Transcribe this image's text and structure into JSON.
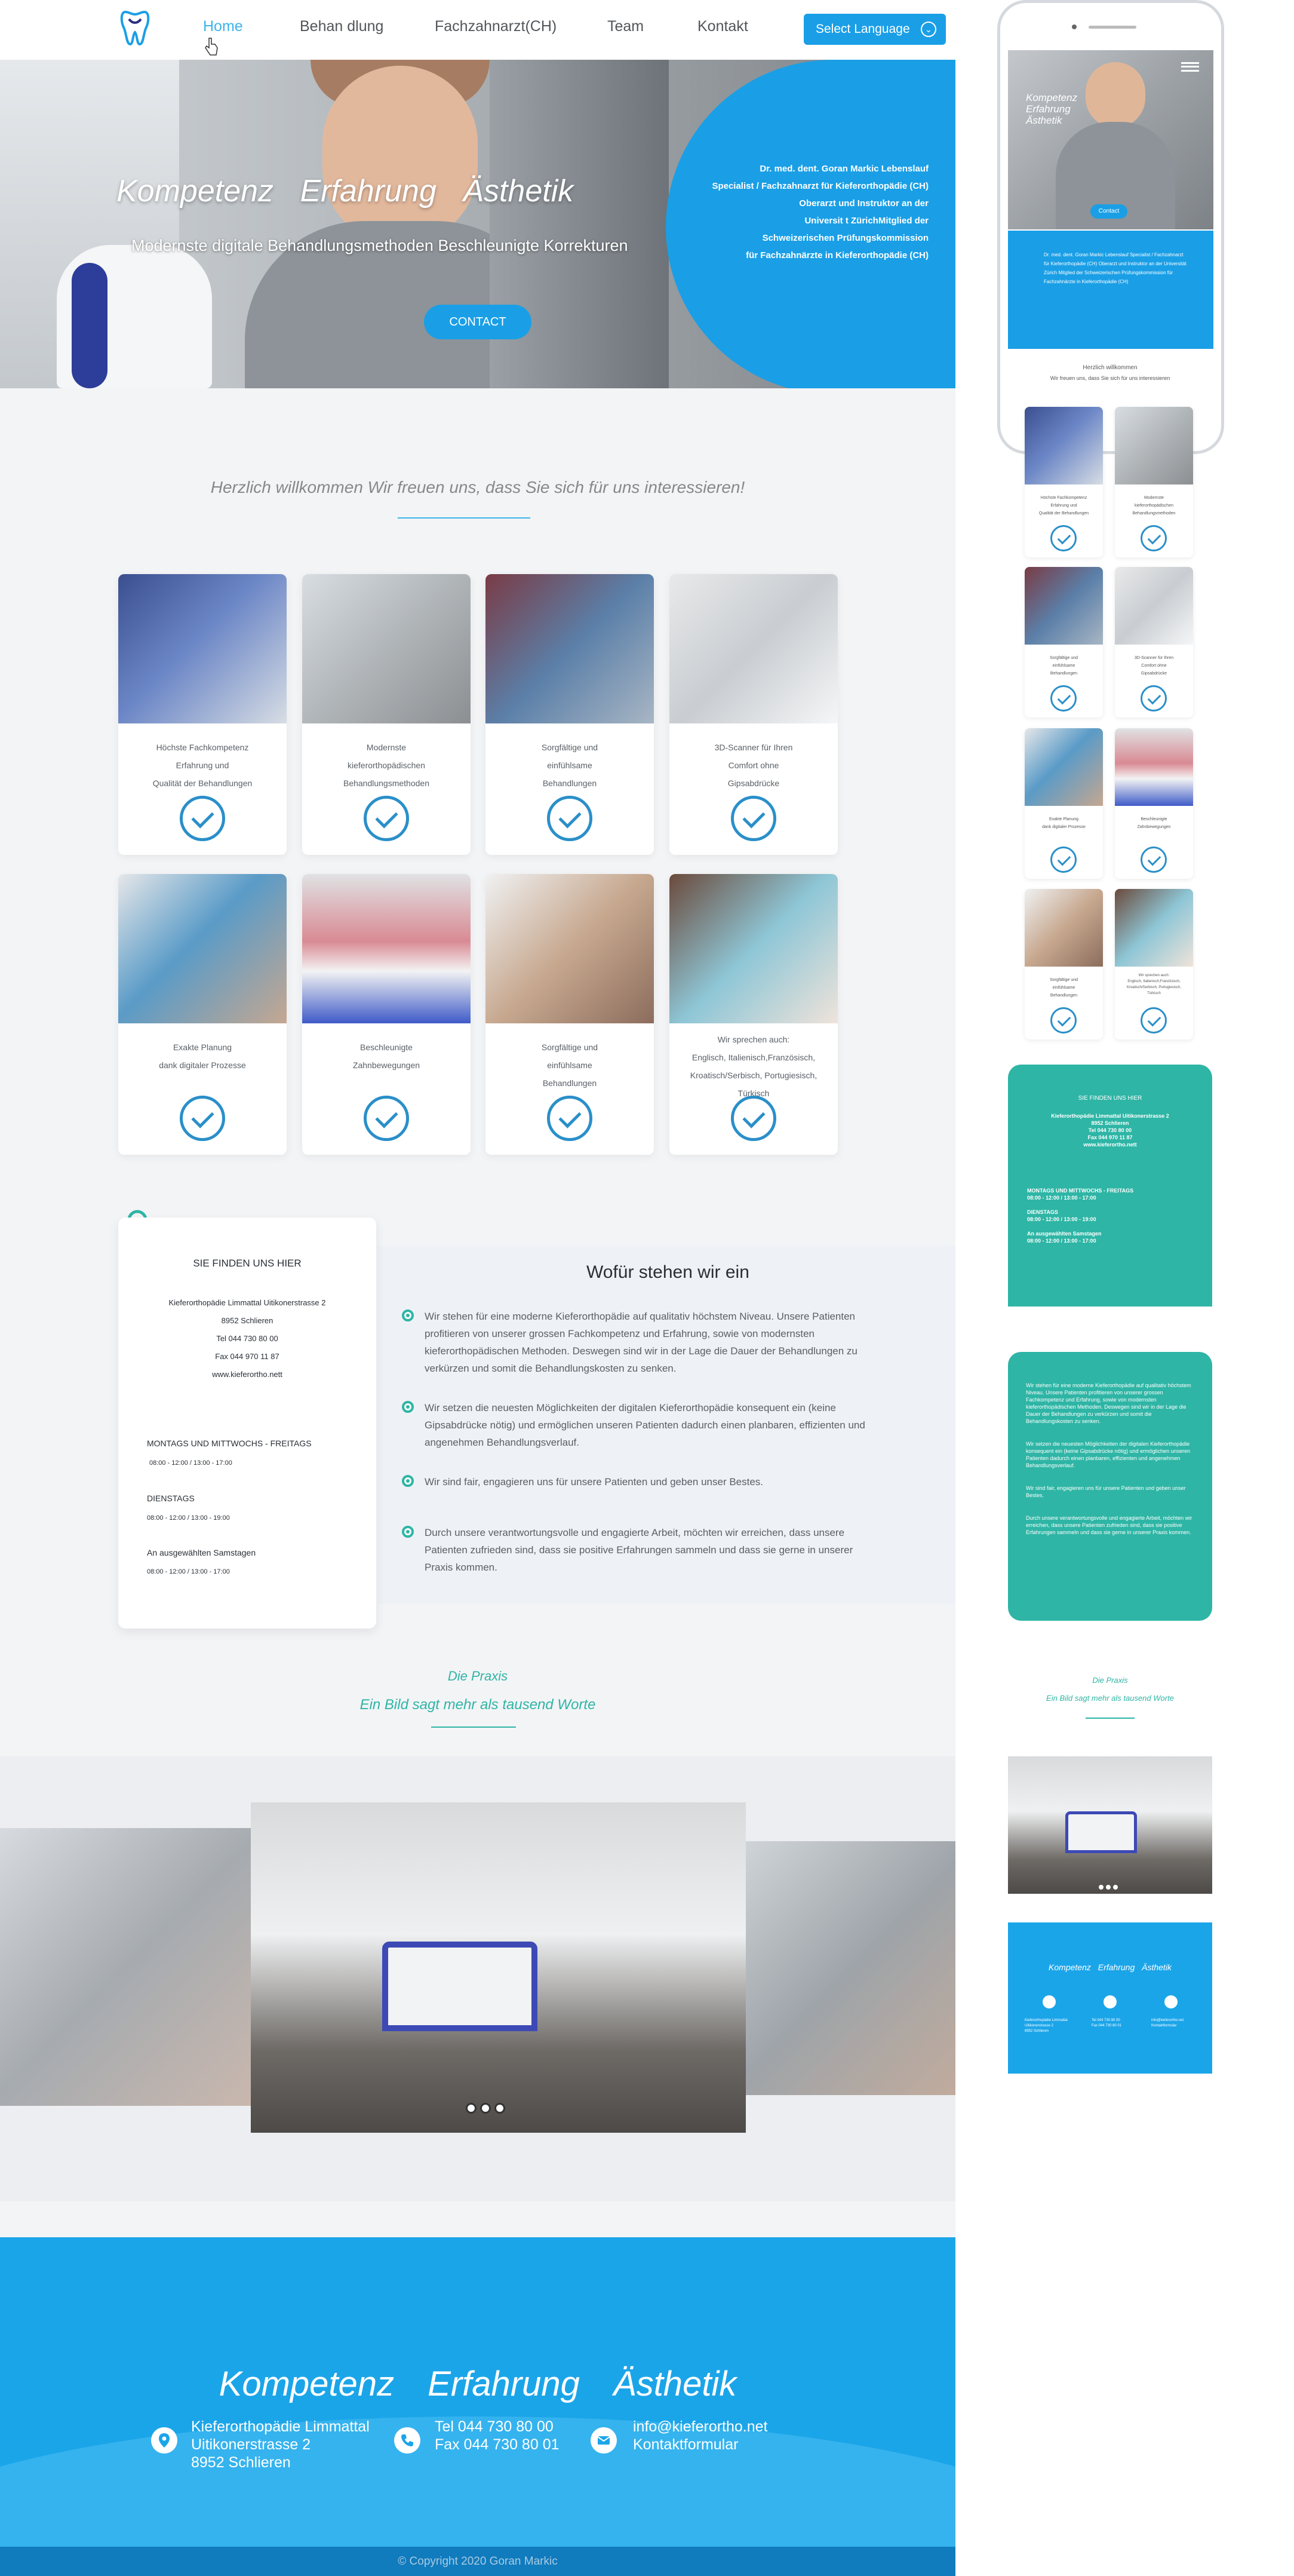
{
  "nav": {
    "items": [
      "Home",
      "Behan dlung",
      "Fachzahnarzt(CH)",
      "Team",
      "Kontakt"
    ],
    "language_button": "Select Language"
  },
  "hero": {
    "title": "Kompetenz  Erfahrung  Ästhetik",
    "subtitle": "Modernste digitale Behandlungsmethoden Beschleunigte Korrekturen",
    "cv_lines": [
      "Dr. med. dent. Goran Markic Lebenslauf",
      "Specialist / Fachzahnarzt für Kieferorthopädie (CH)",
      "Oberarzt und Instruktor an der",
      "Universit t ZürichMitglied der",
      "Schweizerischen Prüfungskommission",
      "für Fachzahnärzte in Kieferorthopädie (CH)"
    ],
    "contact_button": "CONTACT"
  },
  "welcome": "Herzlich willkommen Wir freuen uns, dass Sie sich für uns interessieren!",
  "services": [
    {
      "lines": [
        "Höchste Fachkompetenz",
        "Erfahrung und",
        "Qualität der Behandlungen"
      ]
    },
    {
      "lines": [
        "Modernste",
        "kieferorthopädischen",
        "Behandlungsmethoden"
      ]
    },
    {
      "lines": [
        "Sorgfältige und",
        "einfühlsame",
        "Behandlungen"
      ]
    },
    {
      "lines": [
        "3D-Scanner für Ihren",
        "Comfort ohne",
        "Gipsabdrücke"
      ]
    },
    {
      "lines": [
        "Exakte Planung",
        "dank digitaler Prozesse"
      ]
    },
    {
      "lines": [
        "Beschleunigte",
        "Zahnbewegungen"
      ]
    },
    {
      "lines": [
        "Sorgfältige und",
        "einfühlsame",
        "Behandlungen"
      ]
    },
    {
      "lines": [
        "Wir sprechen auch:",
        "Englisch, Italienisch,Französisch,",
        "Kroatisch/Serbisch, Portugiesisch,",
        "Türkisch"
      ]
    }
  ],
  "info": {
    "heading": "SIE FINDEN UNS HIER",
    "address_lines": [
      "Kieferorthopädie Limmattal Uitikonerstrasse 2",
      "8952 Schlieren",
      "Tel 044 730 80 00",
      "Fax 044 970 11 87",
      "www.kieferortho.nett"
    ],
    "hours": [
      {
        "label": "MONTAGS UND MITTWOCHS - FREITAGS",
        "time": "08:00 - 12:00 / 13:00 - 17:00"
      },
      {
        "label": "DIENSTAGS",
        "time": "08:00 - 12:00 / 13:00 - 19:00"
      },
      {
        "label": "An ausgewählten Samstagen",
        "time": "08:00 - 12:00 / 13:00 - 17:00"
      }
    ]
  },
  "values": {
    "title": "Wofür stehen wir ein",
    "items": [
      "Wir stehen für eine moderne Kieferorthopädie auf qualitativ höchstem Niveau. Unsere Patienten profitieren von unserer grossen Fachkompetenz und Erfahrung, sowie von modernsten kieferorthopädischen Methoden. Deswegen sind wir in der Lage die Dauer der Behandlungen zu verkürzen und somit die Behandlungskosten zu senken.",
      "Wir setzen die neuesten Möglichkeiten der digitalen Kieferorthopädie konsequent ein (keine Gipsabdrücke nötig) und ermöglichen unseren Patienten dadurch einen planbaren, effizienten und angenehmen Behandlungsverlauf.",
      "Wir sind fair, engagieren uns für unsere Patienten und geben unser Bestes.",
      "Durch unsere verantwortungsvolle und engagierte Arbeit, möchten wir erreichen, dass unsere Patienten zufrieden sind, dass sie positive Erfahrungen sammeln und dass sie gerne in unserer Praxis kommen."
    ]
  },
  "praxis": {
    "title": "Die Praxis",
    "subtitle": "Ein Bild sagt mehr als tausend Worte"
  },
  "footer": {
    "slogan": "Kompetenz  Erfahrung  Ästhetik",
    "address": [
      "Kieferorthopädie Limmattal",
      "Uitikonerstrasse 2",
      "8952 Schlieren"
    ],
    "phone": [
      "Tel 044 730 80 00",
      "Fax 044 730 80 01"
    ],
    "email": [
      "info@kieferortho.net",
      "Kontaktformular"
    ],
    "copyright": "© Copyright 2020  Goran Markic"
  },
  "mobile": {
    "hero_title": [
      "Kompetenz",
      "Erfahrung",
      "Ästhetik"
    ],
    "contact": "Contact",
    "cv": "Dr. med. dent. Goran Markic Lebenslauf Specialist / Fachzahnarzt für Kieferorthopädie (CH) Oberarzt und Instruktor an der Universität Zürich Mitglied der Schweizerischen Prüfungskommission für Fachzahnärzte in Kieferorthopädie (CH)",
    "welcome_title": "Herzlich willkommen",
    "welcome_sub": "Wir freuen uns, dass Sie sich für uns interessieren",
    "find_heading": "SIE FINDEN UNS HIER",
    "find_lines": [
      "Kieferorthopädie Limmattal Uitikonerstrasse 2",
      "8952 Schlieren",
      "Tel 044 730 80 00",
      "Fax 044 970 11 87",
      "www.kieferortho.nett"
    ],
    "hours": [
      "MONTAGS UND MITTWOCHS - FREITAGS",
      "08:00 - 12:00 / 13:00 - 17:00",
      "DIENSTAGS",
      "08:00 - 12:00 / 13:00 - 19:00",
      "An ausgewählten Samstagen",
      "08:00 - 12:00 / 13:00 - 17:00"
    ],
    "praxis_title": "Die Praxis",
    "praxis_sub": "Ein Bild sagt mehr als tausend Worte",
    "footer_slogan": "Kompetenz  Erfahrung  Ästhetik"
  },
  "colors": {
    "brand_blue": "#1a9fe6",
    "teal": "#2eb5a5",
    "check": "#2a8fc9"
  }
}
